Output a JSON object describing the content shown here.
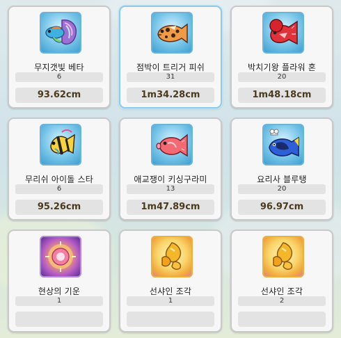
{
  "items": [
    {
      "name": "무지갯빛 베타",
      "count": "6",
      "size": "93.62cm",
      "icon": "rainbow-betta-fish-icon",
      "selected": false
    },
    {
      "name": "점박이 트리거 피쉬",
      "count": "31",
      "size": "1m34.28cm",
      "icon": "spotted-triggerfish-icon",
      "selected": true
    },
    {
      "name": "박치기왕 플라워 혼",
      "count": "20",
      "size": "1m48.18cm",
      "icon": "flowerhorn-fish-icon",
      "selected": false
    },
    {
      "name": "무리쉬 아이돌 스타",
      "count": "6",
      "size": "95.26cm",
      "icon": "moorish-idol-fish-icon",
      "selected": false
    },
    {
      "name": "애교쟁이 키싱구라미",
      "count": "13",
      "size": "1m47.89cm",
      "icon": "kissing-gourami-fish-icon",
      "selected": false
    },
    {
      "name": "요리사 블루탱",
      "count": "20",
      "size": "96.97cm",
      "icon": "chef-blue-tang-fish-icon",
      "selected": false
    },
    {
      "name": "현상의 기운",
      "count": "1",
      "size": "",
      "icon": "glowing-orb-icon",
      "selected": false
    },
    {
      "name": "선샤인 조각",
      "count": "1",
      "size": "",
      "icon": "sunshine-fragment-icon",
      "selected": false
    },
    {
      "name": "선샤인 조각",
      "count": "2",
      "size": "",
      "icon": "sunshine-fragment-icon",
      "selected": false
    }
  ]
}
